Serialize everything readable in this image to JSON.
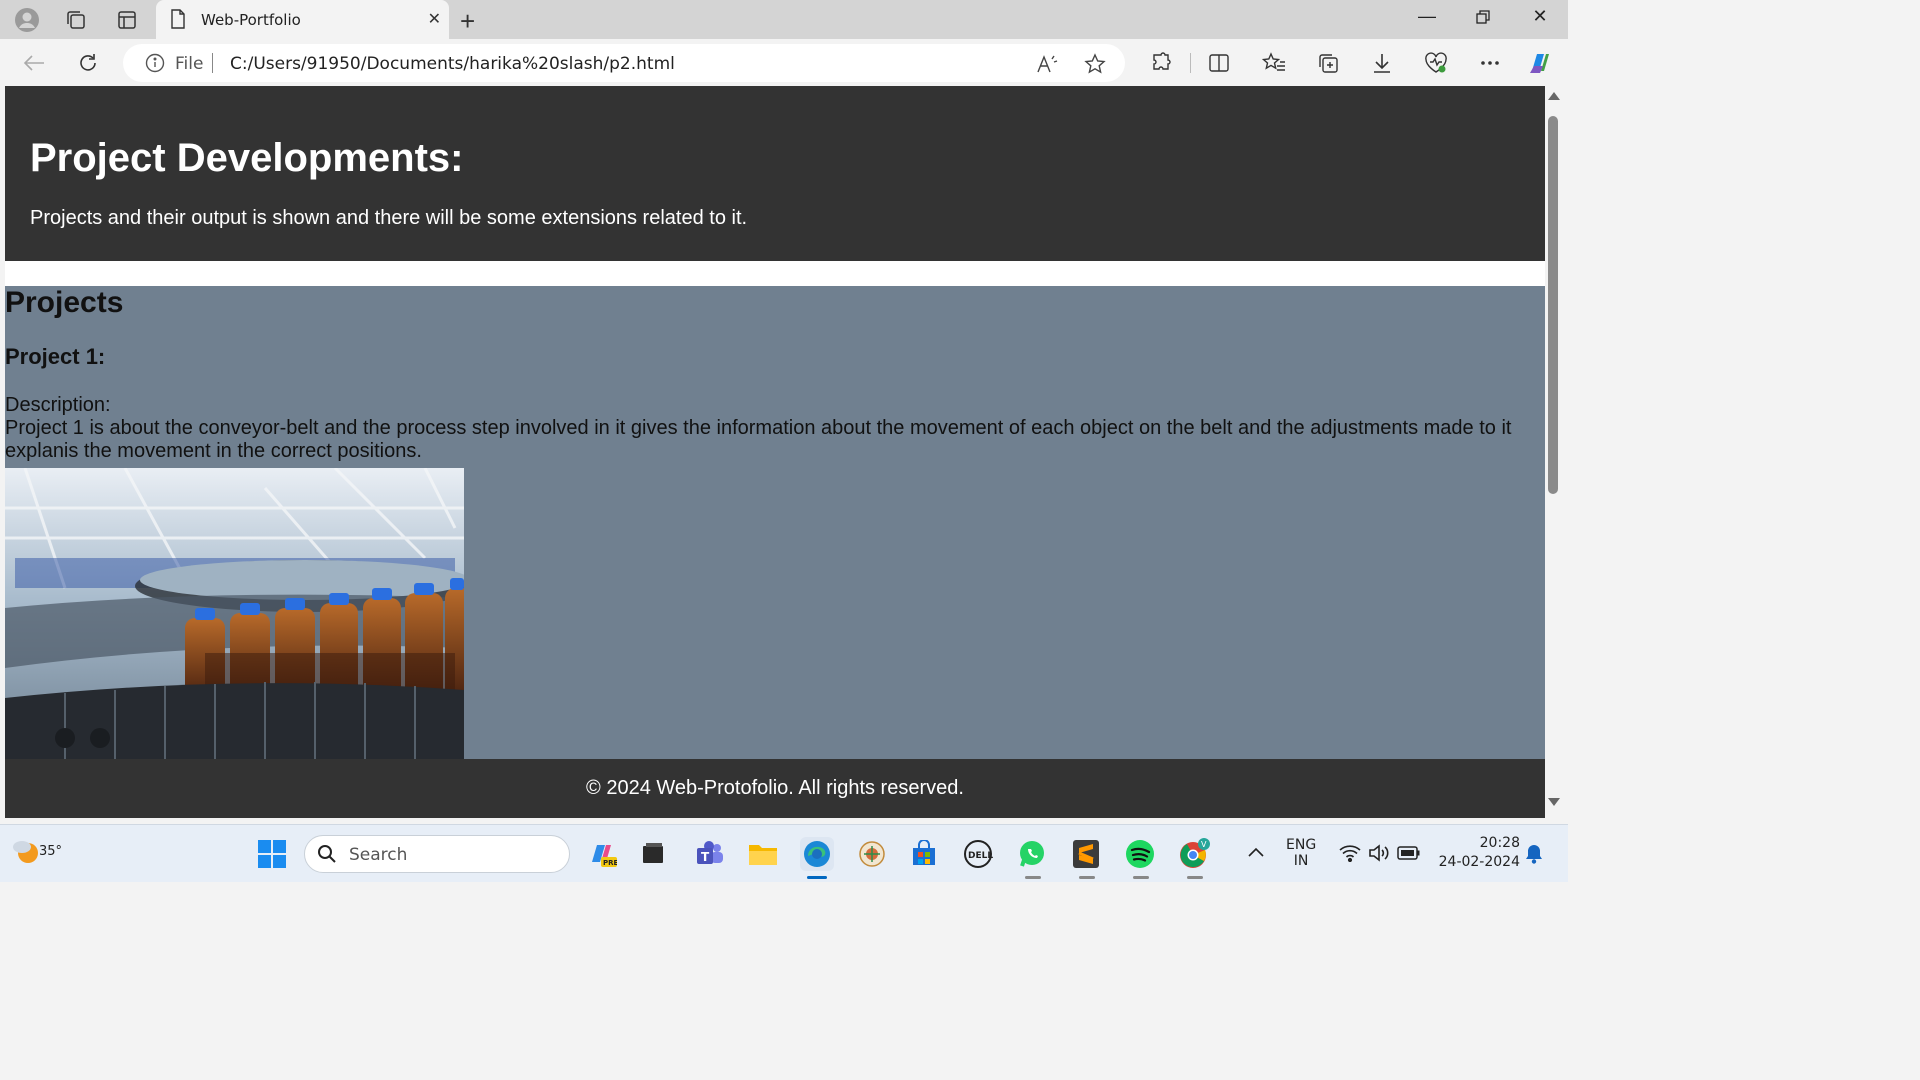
{
  "browser": {
    "tab_title": "Web-Portfolio",
    "omnibox_scheme": "File",
    "url": "C:/Users/91950/Documents/harika%20slash/p2.html"
  },
  "page": {
    "hero_title": "Project Developments:",
    "hero_subtitle": "Projects and their output is shown and there will be some extensions related to it.",
    "projects_heading": "Projects",
    "project1_title": "Project 1:",
    "description_label": "Description:",
    "project1_description": "Project 1 is about the conveyor-belt and the process step involved in it gives the information about the movement of each object on the belt and the adjustments made to it explanis the movement in the correct positions.",
    "footer_text": "© 2024 Web-Protofolio. All rights reserved."
  },
  "colors": {
    "hero_bg": "#333333",
    "projects_bg": "#708090",
    "footer_bg": "#333333"
  },
  "taskbar": {
    "weather_temp": "35°",
    "search_label": "Search",
    "language_line1": "ENG",
    "language_line2": "IN",
    "time": "20:28",
    "date": "24-02-2024"
  }
}
